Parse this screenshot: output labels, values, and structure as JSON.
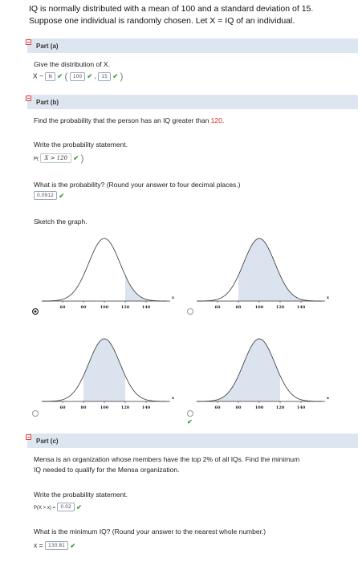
{
  "intro": {
    "line1": "IQ is normally distributed with a mean of 100 and a standard deviation of 15.",
    "line2": "Suppose one individual is randomly chosen. Let X = IQ of an individual."
  },
  "part_a": {
    "header": "Part (a)",
    "prompt": "Give the distribution of X.",
    "lead": "X ~",
    "dist_value": "N",
    "mean_value": "100",
    "sd_value": "15"
  },
  "part_b": {
    "header": "Part (b)",
    "question_prefix": "Find the probability that the person has an IQ greater than ",
    "question_value": "120",
    "question_suffix": ".",
    "statement_label": "Write the probability statement.",
    "statement_prefix": "P(",
    "statement_expr": "X > 120",
    "prob_label": "What is the probability? (Round your answer to four decimal places.)",
    "prob_value": "0.0912",
    "sketch_label": "Sketch the graph.",
    "graphs": [
      {
        "id": "a",
        "ticks": [
          "60",
          "80",
          "100",
          "120",
          "140"
        ],
        "axis_label": "x",
        "shade_from": 120,
        "shade_to": 160,
        "selected": true
      },
      {
        "id": "b",
        "ticks": [
          "60",
          "80",
          "100",
          "120",
          "140"
        ],
        "axis_label": "x",
        "shade_from": 80,
        "shade_to": 160,
        "selected": false
      },
      {
        "id": "c",
        "ticks": [
          "60",
          "80",
          "100",
          "120",
          "140"
        ],
        "axis_label": "x",
        "shade_from": 80,
        "shade_to": 120,
        "selected": false
      },
      {
        "id": "d",
        "ticks": [
          "60",
          "80",
          "100",
          "120",
          "140"
        ],
        "axis_label": "x",
        "shade_from": 40,
        "shade_to": 120,
        "selected": false
      }
    ]
  },
  "part_c": {
    "header": "Part (c)",
    "question_line1": "Mensa is an organization whose members have the top 2% of all IQs. Find the minimum",
    "question_line2": "IQ needed to qualify for the Mensa organization.",
    "statement_label": "Write the probability statement.",
    "statement_prefix": "P(X > x) =",
    "statement_value": "0.02",
    "min_label": "What is the minimum IQ? (Round your answer to the nearest whole number.)",
    "min_prefix": "x =",
    "min_value": "130.81"
  },
  "colors": {
    "header_bg": "#dde6f0",
    "shade": "#dbe3ef",
    "check": "#3a9a3a",
    "accent_red": "#e03020"
  }
}
